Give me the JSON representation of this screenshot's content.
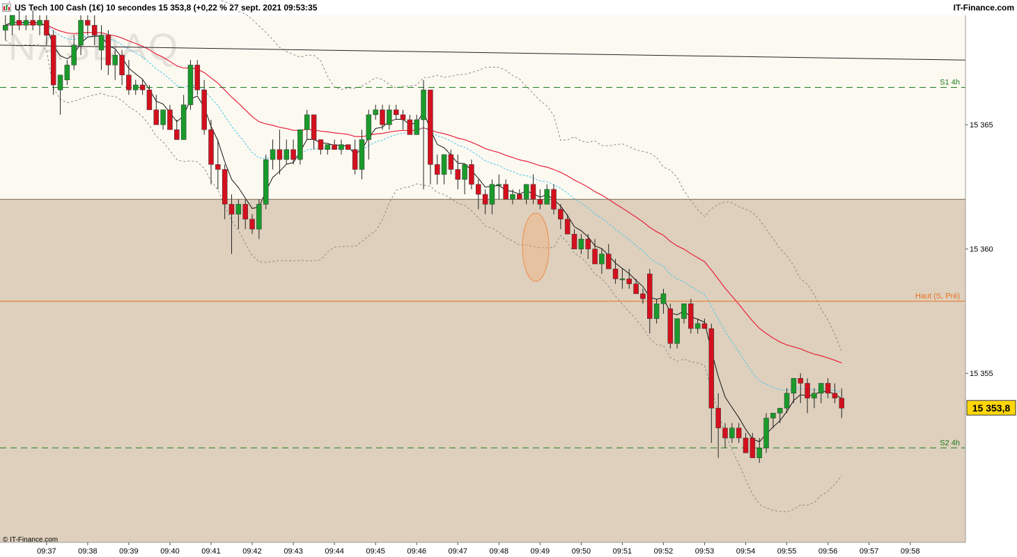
{
  "header": {
    "title": "US Tech 100 Cash (1€) 10 secondes 15 353,8 (+0,22 % 27 sept. 2021 09:53:35",
    "brand": "IT-Finance.com"
  },
  "watermark": "NASDAQ",
  "copyright": "© IT-Finance.com",
  "colors": {
    "up": "#1a9a2a",
    "down": "#d4101e",
    "upper_zone": "#fcf9f1",
    "lower_zone": "#ded0bd",
    "ma_fast": "#111111",
    "ma_mid": "#4cc6ec",
    "ma_slow": "#e8203a",
    "band": "#8a8a8a",
    "support": "#1d7a1d",
    "haut": "#e8701e"
  },
  "chart_data": {
    "type": "candlestick",
    "instrument": "US Tech 100 Cash (1€)",
    "interval": "10 secondes",
    "last_price": "15 353,8",
    "change": "+0,22 %",
    "date": "27 sept. 2021",
    "time": "09:53:35",
    "y_ticks": [
      "15 355",
      "15 360",
      "15 365"
    ],
    "y_tick_values": [
      15355,
      15360,
      15365
    ],
    "ylim": [
      15348.2,
      15369.4
    ],
    "x_ticks": [
      "09:37",
      "09:38",
      "09:39",
      "09:40",
      "09:41",
      "09:42",
      "09:43",
      "09:44",
      "09:45",
      "09:46",
      "09:47",
      "09:48",
      "09:49",
      "09:50",
      "09:51",
      "09:52",
      "09:53",
      "09:54",
      "09:55",
      "09:56",
      "09:57",
      "09:58"
    ],
    "x_tick_indices": [
      6,
      12,
      18,
      24,
      30,
      36,
      42,
      48,
      54,
      60,
      66,
      72,
      78,
      84,
      90,
      96,
      102,
      108,
      114,
      120,
      126,
      132
    ],
    "levels": [
      {
        "label": "S1 4h",
        "value": 15366.5
      },
      {
        "label": "Haut (S, Pré)",
        "value": 15357.9
      },
      {
        "label": "S2 4h",
        "value": 15352.0
      }
    ],
    "zone_boundary": 15362.0,
    "trendline": {
      "start": [
        0,
        15368.2
      ],
      "end": [
        138,
        15367.6
      ]
    },
    "candles": [
      [
        15368.8,
        15369.4,
        15368.4,
        15369.0
      ],
      [
        15369.0,
        15369.2,
        15368.6,
        15369.4
      ],
      [
        15369.2,
        15369.6,
        15368.8,
        15369.0
      ],
      [
        15369.0,
        15369.4,
        15368.8,
        15369.2
      ],
      [
        15369.2,
        15369.6,
        15368.8,
        15369.0
      ],
      [
        15369.0,
        15369.4,
        15368.6,
        15369.2
      ],
      [
        15369.2,
        15369.4,
        15368.2,
        15368.6
      ],
      [
        15368.6,
        15368.8,
        15366.2,
        15366.6
      ],
      [
        15366.4,
        15366.8,
        15365.4,
        15367.0
      ],
      [
        15366.8,
        15367.6,
        15366.6,
        15367.4
      ],
      [
        15367.4,
        15368.6,
        15367.2,
        15368.2
      ],
      [
        15368.2,
        15369.4,
        15367.8,
        15369.2
      ],
      [
        15369.2,
        15369.4,
        15368.6,
        15369.0
      ],
      [
        15369.0,
        15369.4,
        15368.2,
        15368.6
      ],
      [
        15368.0,
        15369.0,
        15367.2,
        15368.6
      ],
      [
        15368.6,
        15368.8,
        15367.0,
        15367.4
      ],
      [
        15367.4,
        15368.0,
        15366.8,
        15367.8
      ],
      [
        15367.8,
        15368.0,
        15366.6,
        15367.0
      ],
      [
        15367.0,
        15367.6,
        15366.2,
        15366.4
      ],
      [
        15366.4,
        15366.8,
        15366.2,
        15366.6
      ],
      [
        15366.6,
        15366.8,
        15366.2,
        15366.4
      ],
      [
        15366.4,
        15366.6,
        15365.8,
        15365.6
      ],
      [
        15365.6,
        15366.2,
        15365.0,
        15365.0
      ],
      [
        15365.0,
        15365.6,
        15364.8,
        15365.6
      ],
      [
        15365.6,
        15365.8,
        15365.0,
        15364.8
      ],
      [
        15364.8,
        15365.2,
        15364.4,
        15364.4
      ],
      [
        15364.4,
        15366.2,
        15364.8,
        15365.8
      ],
      [
        15365.8,
        15367.6,
        15365.6,
        15367.4
      ],
      [
        15367.4,
        15367.6,
        15366.2,
        15366.4
      ],
      [
        15366.4,
        15366.8,
        15364.6,
        15364.8
      ],
      [
        15364.8,
        15365.2,
        15362.6,
        15363.4
      ],
      [
        15363.4,
        15364.4,
        15362.4,
        15363.2
      ],
      [
        15363.2,
        15363.4,
        15361.2,
        15361.8
      ],
      [
        15361.8,
        15362.2,
        15359.8,
        15361.4
      ],
      [
        15361.4,
        15362.0,
        15360.8,
        15361.8
      ],
      [
        15361.8,
        15362.0,
        15360.8,
        15361.2
      ],
      [
        15361.2,
        15361.4,
        15360.6,
        15360.8
      ],
      [
        15360.8,
        15362.0,
        15360.4,
        15361.8
      ],
      [
        15361.8,
        15363.8,
        15361.6,
        15363.6
      ],
      [
        15363.6,
        15364.4,
        15363.2,
        15364.0
      ],
      [
        15364.0,
        15364.8,
        15363.0,
        15363.6
      ],
      [
        15363.6,
        15364.4,
        15363.4,
        15364.0
      ],
      [
        15364.0,
        15364.4,
        15363.4,
        15363.6
      ],
      [
        15363.6,
        15364.4,
        15363.4,
        15364.8
      ],
      [
        15364.8,
        15365.6,
        15364.4,
        15365.4
      ],
      [
        15365.4,
        15365.2,
        15364.0,
        15364.4
      ],
      [
        15364.4,
        15364.2,
        15363.8,
        15364.0
      ],
      [
        15364.0,
        15364.2,
        15363.8,
        15364.2
      ],
      [
        15364.2,
        15364.4,
        15364.0,
        15364.0
      ],
      [
        15364.0,
        15364.4,
        15363.8,
        15364.2
      ],
      [
        15364.2,
        15364.2,
        15364.0,
        15364.0
      ],
      [
        15364.0,
        15364.4,
        15363.0,
        15363.2
      ],
      [
        15363.2,
        15364.8,
        15362.8,
        15364.4
      ],
      [
        15364.4,
        15365.6,
        15363.6,
        15365.4
      ],
      [
        15365.4,
        15365.8,
        15365.2,
        15365.6
      ],
      [
        15365.6,
        15365.8,
        15364.8,
        15365.0
      ],
      [
        15365.0,
        15365.8,
        15364.8,
        15365.6
      ],
      [
        15365.6,
        15365.8,
        15365.2,
        15365.4
      ],
      [
        15365.4,
        15365.6,
        15364.8,
        15365.2
      ],
      [
        15365.2,
        15365.4,
        15364.6,
        15364.6
      ],
      [
        15364.6,
        15365.4,
        15364.6,
        15365.2
      ],
      [
        15365.2,
        15366.8,
        15362.4,
        15366.4
      ],
      [
        15366.4,
        15363.6,
        15362.6,
        15363.4
      ],
      [
        15363.4,
        15363.8,
        15362.6,
        15363.0
      ],
      [
        15363.0,
        15363.6,
        15362.6,
        15363.8
      ],
      [
        15363.8,
        15364.0,
        15363.0,
        15363.2
      ],
      [
        15363.2,
        15363.8,
        15362.4,
        15362.8
      ],
      [
        15362.8,
        15363.4,
        15362.2,
        15363.4
      ],
      [
        15363.4,
        15363.6,
        15362.4,
        15362.6
      ],
      [
        15362.6,
        15362.8,
        15361.6,
        15362.2
      ],
      [
        15362.2,
        15362.4,
        15361.4,
        15361.8
      ],
      [
        15361.8,
        15362.8,
        15361.4,
        15362.6
      ],
      [
        15362.6,
        15363.0,
        15362.0,
        15362.6
      ],
      [
        15362.6,
        15362.8,
        15362.2,
        15362.0
      ],
      [
        15362.0,
        15362.4,
        15361.8,
        15362.2
      ],
      [
        15362.2,
        15362.4,
        15362.0,
        15362.0
      ],
      [
        15362.0,
        15362.6,
        15361.8,
        15362.6
      ],
      [
        15362.6,
        15363.0,
        15361.8,
        15362.0
      ],
      [
        15362.0,
        15362.4,
        15361.6,
        15361.8
      ],
      [
        15361.8,
        15362.6,
        15361.8,
        15362.4
      ],
      [
        15362.4,
        15362.6,
        15361.4,
        15361.6
      ],
      [
        15361.6,
        15361.8,
        15360.8,
        15361.2
      ],
      [
        15361.2,
        15361.4,
        15360.6,
        15360.6
      ],
      [
        15360.6,
        15360.8,
        15360.0,
        15360.0
      ],
      [
        15360.0,
        15360.6,
        15359.8,
        15360.4
      ],
      [
        15360.4,
        15360.6,
        15359.6,
        15360.0
      ],
      [
        15360.0,
        15360.4,
        15359.6,
        15359.4
      ],
      [
        15359.4,
        15360.0,
        15359.0,
        15359.8
      ],
      [
        15359.8,
        15360.2,
        15359.2,
        15359.2
      ],
      [
        15359.2,
        15359.6,
        15358.6,
        15358.8
      ],
      [
        15358.8,
        15359.2,
        15358.4,
        15358.8
      ],
      [
        15358.8,
        15359.2,
        15358.4,
        15358.6
      ],
      [
        15358.6,
        15358.8,
        15358.2,
        15358.2
      ],
      [
        15358.2,
        15358.4,
        15357.8,
        15358.0
      ],
      [
        15359.0,
        15359.2,
        15356.6,
        15357.2
      ],
      [
        15357.2,
        15358.0,
        15357.0,
        15357.8
      ],
      [
        15357.8,
        15358.4,
        15357.4,
        15358.2
      ],
      [
        15357.6,
        15357.8,
        15356.0,
        15356.2
      ],
      [
        15356.2,
        15357.2,
        15356.0,
        15357.2
      ],
      [
        15357.2,
        15357.8,
        15357.0,
        15357.8
      ],
      [
        15357.8,
        15358.0,
        15356.6,
        15356.8
      ],
      [
        15356.8,
        15357.2,
        15356.6,
        15357.0
      ],
      [
        15357.0,
        15357.2,
        15356.8,
        15356.8
      ],
      [
        15356.8,
        15357.0,
        15352.2,
        15353.6
      ],
      [
        15353.6,
        15354.2,
        15351.6,
        15352.8
      ],
      [
        15352.8,
        15353.0,
        15352.0,
        15352.4
      ],
      [
        15352.4,
        15353.0,
        15352.2,
        15352.8
      ],
      [
        15352.8,
        15353.0,
        15352.2,
        15352.4
      ],
      [
        15352.4,
        15352.6,
        15351.8,
        15351.8
      ],
      [
        15352.4,
        15352.6,
        15351.6,
        15351.6
      ],
      [
        15351.6,
        15352.4,
        15351.4,
        15352.0
      ],
      [
        15352.0,
        15353.4,
        15351.8,
        15353.2
      ],
      [
        15353.2,
        15353.4,
        15352.8,
        15353.4
      ],
      [
        15353.4,
        15353.6,
        15353.0,
        15353.6
      ],
      [
        15353.6,
        15354.4,
        15353.4,
        15354.2
      ],
      [
        15354.2,
        15354.8,
        15353.8,
        15354.8
      ],
      [
        15354.8,
        15355.0,
        15353.8,
        15354.6
      ],
      [
        15354.6,
        15354.8,
        15353.4,
        15354.0
      ],
      [
        15354.0,
        15354.4,
        15353.6,
        15354.2
      ],
      [
        15354.2,
        15354.6,
        15353.8,
        15354.6
      ],
      [
        15354.6,
        15354.8,
        15354.0,
        15354.2
      ],
      [
        15354.2,
        15354.6,
        15353.8,
        15354.0
      ],
      [
        15354.0,
        15354.4,
        15353.2,
        15353.6
      ]
    ]
  }
}
